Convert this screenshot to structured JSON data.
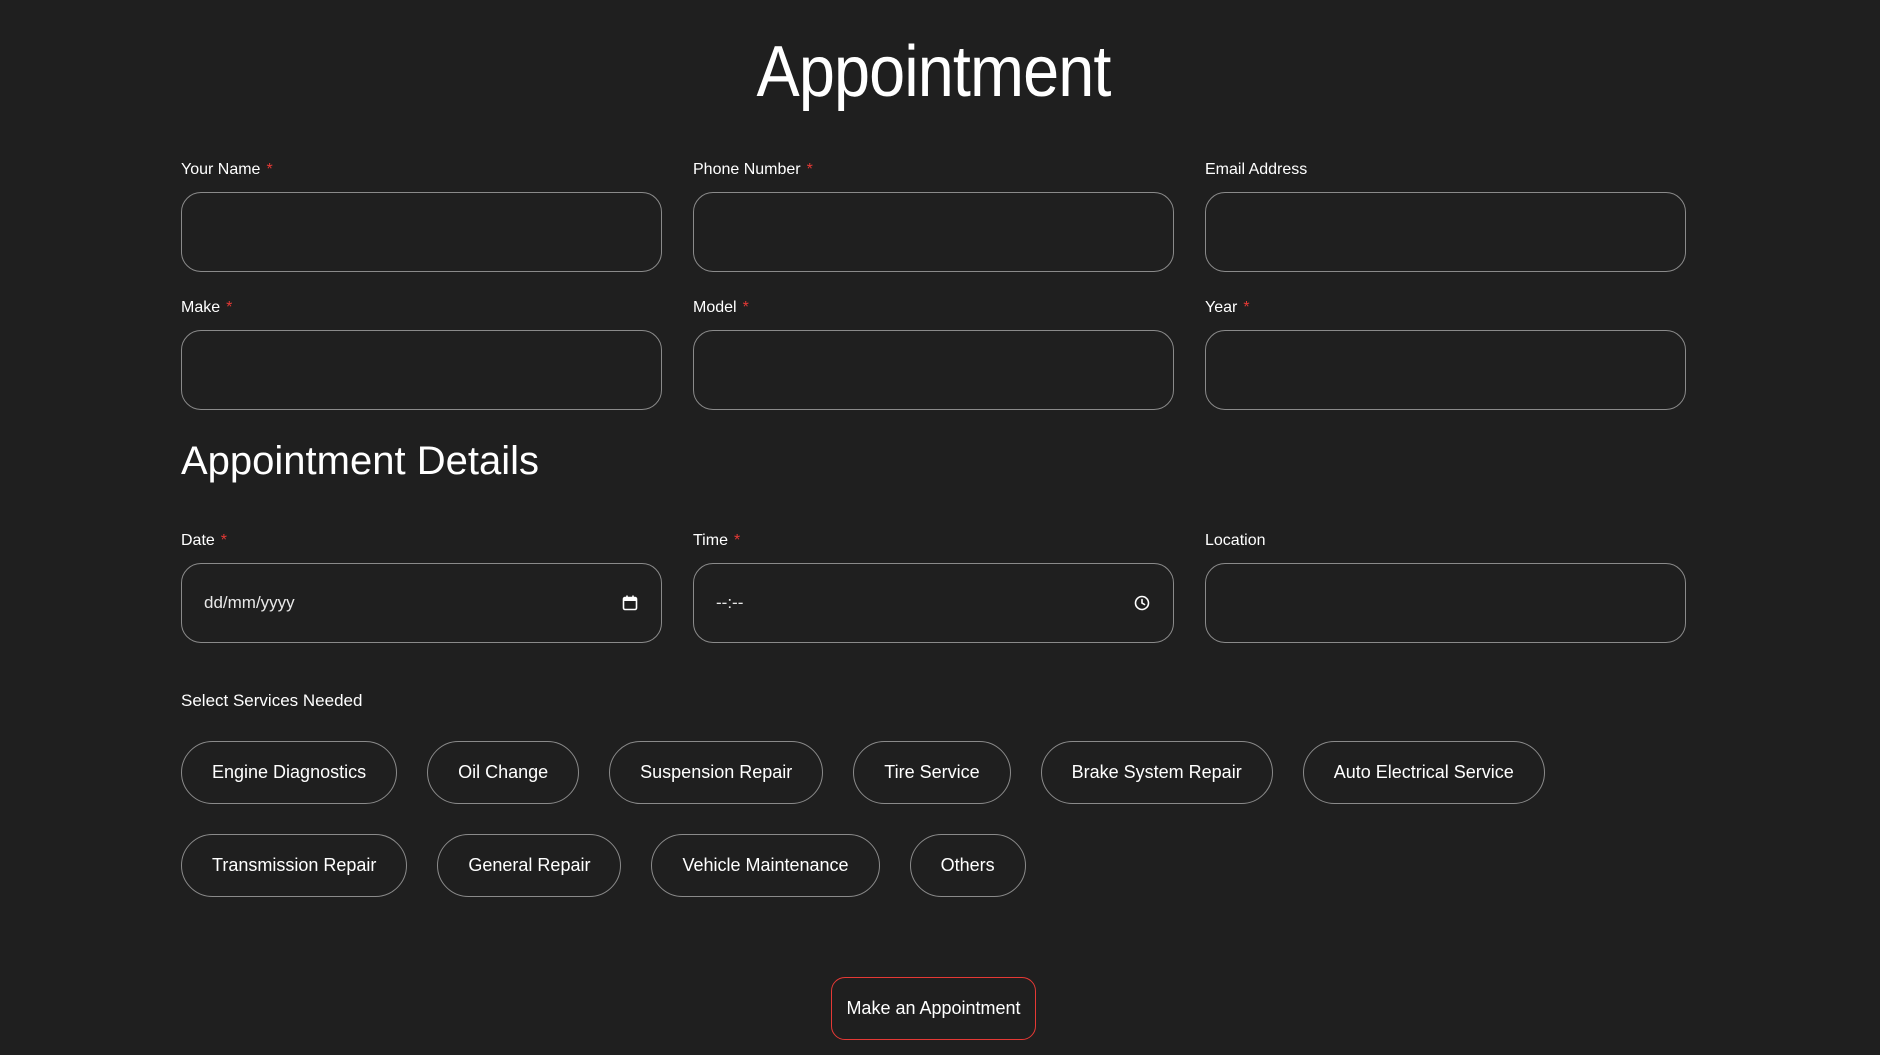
{
  "page": {
    "title": "Appointment",
    "accent_color": "#e53935",
    "background_color": "#1f1f1f"
  },
  "contact": {
    "name": {
      "label": "Your Name",
      "required": "*",
      "value": ""
    },
    "phone": {
      "label": "Phone Number",
      "required": "*",
      "value": ""
    },
    "email": {
      "label": "Email Address",
      "value": ""
    }
  },
  "vehicle": {
    "make": {
      "label": "Make",
      "required": "*",
      "value": ""
    },
    "model": {
      "label": "Model",
      "required": "*",
      "value": ""
    },
    "year": {
      "label": "Year",
      "required": "*",
      "value": ""
    }
  },
  "details": {
    "title": "Appointment Details",
    "date": {
      "label": "Date",
      "required": "*",
      "placeholder": "dd/mm/yyyy",
      "icon": "calendar-icon"
    },
    "time": {
      "label": "Time",
      "required": "*",
      "placeholder": "--:--",
      "icon": "clock-icon"
    },
    "location": {
      "label": "Location",
      "value": ""
    }
  },
  "services": {
    "label": "Select Services Needed",
    "options": [
      "Engine Diagnostics",
      "Oil Change",
      "Suspension Repair",
      "Tire Service",
      "Brake System Repair",
      "Auto Electrical Service",
      "Transmission Repair",
      "General Repair",
      "Vehicle Maintenance",
      "Others"
    ]
  },
  "submit": {
    "label": "Make an Appointment"
  }
}
